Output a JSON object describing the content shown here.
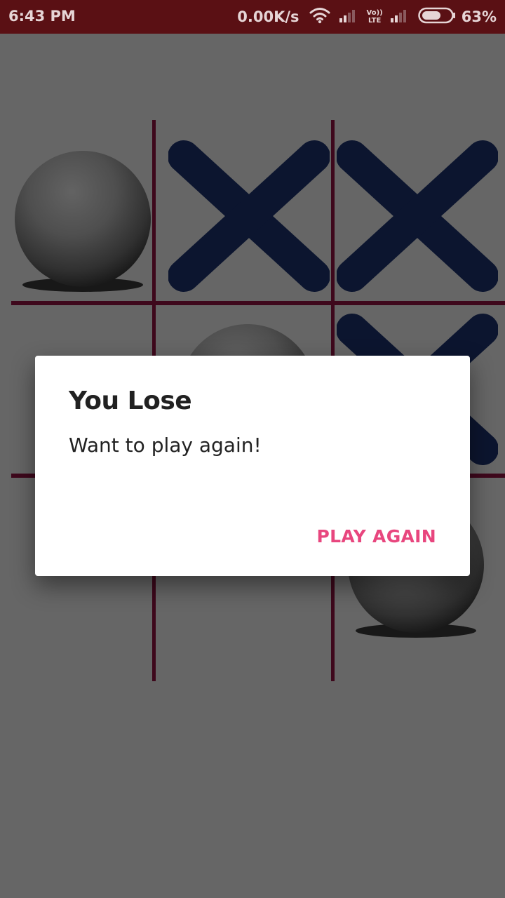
{
  "status_bar": {
    "time": "6:43 PM",
    "network_speed": "0.00K/s",
    "volte_top": "Vo))",
    "volte_bottom": "LTE",
    "battery": "63%",
    "battery_level": 0.63,
    "icons": [
      "wifi-icon",
      "signal-icon",
      "volte-icon",
      "signal-icon",
      "battery-icon"
    ]
  },
  "board": {
    "cells": [
      [
        "O",
        "X",
        "X"
      ],
      [
        "",
        "O",
        "X"
      ],
      [
        "",
        "",
        "O"
      ]
    ],
    "colors": {
      "grid_line": "#9c1646",
      "x_mark": "#1e3577"
    }
  },
  "dialog": {
    "title": "You Lose",
    "message": "Want to play again!",
    "button": "PLAY AGAIN",
    "button_color": "#e8467e"
  }
}
